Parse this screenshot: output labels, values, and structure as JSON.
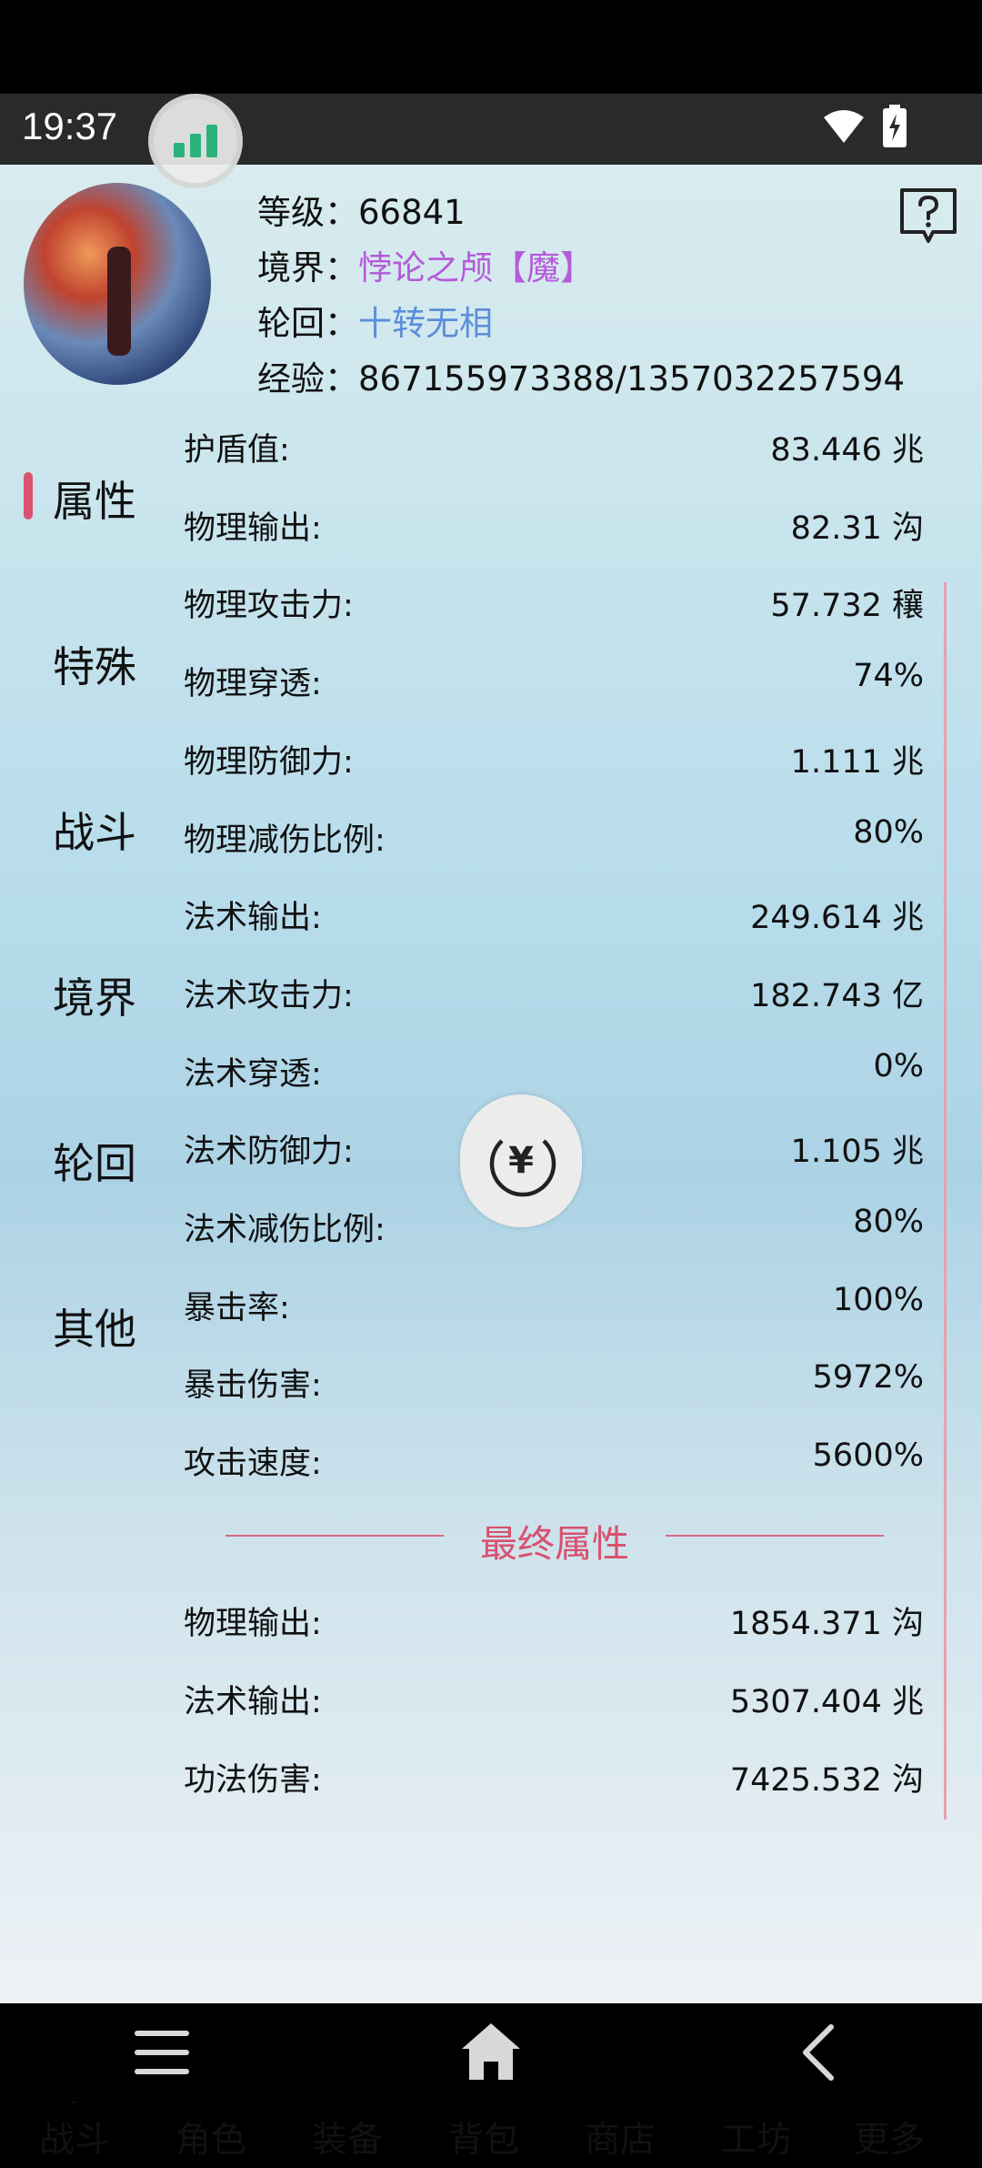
{
  "status_bar": {
    "time": "19:37"
  },
  "profile": {
    "level_label": "等级：",
    "level_value": "66841",
    "realm_label": "境界：",
    "realm_value": "悖论之颅【魔】",
    "reincarnation_label": "轮回：",
    "reincarnation_value": "十转无相",
    "exp_label": "经验：",
    "exp_value": "867155973388/1357032257594"
  },
  "side_tabs": [
    {
      "label": "属性",
      "active": true
    },
    {
      "label": "特殊",
      "active": false
    },
    {
      "label": "战斗",
      "active": false
    },
    {
      "label": "境界",
      "active": false
    },
    {
      "label": "轮回",
      "active": false
    },
    {
      "label": "其他",
      "active": false
    }
  ],
  "stats": [
    {
      "label": "护盾值:",
      "value": "83.446 兆"
    },
    {
      "label": "物理输出:",
      "value": "82.31 沟"
    },
    {
      "label": "物理攻击力:",
      "value": "57.732 穰"
    },
    {
      "label": "物理穿透:",
      "value": "74%"
    },
    {
      "label": "物理防御力:",
      "value": "1.111 兆"
    },
    {
      "label": "物理减伤比例:",
      "value": "80%"
    },
    {
      "label": "法术输出:",
      "value": "249.614 兆"
    },
    {
      "label": "法术攻击力:",
      "value": "182.743 亿"
    },
    {
      "label": "法术穿透:",
      "value": "0%"
    },
    {
      "label": "法术防御力:",
      "value": "1.105 兆"
    },
    {
      "label": "法术减伤比例:",
      "value": "80%"
    },
    {
      "label": "暴击率:",
      "value": "100%"
    },
    {
      "label": "暴击伤害:",
      "value": "5972%"
    },
    {
      "label": "攻击速度:",
      "value": "5600%"
    }
  ],
  "final_section": {
    "title": "最终属性",
    "stats": [
      {
        "label": "物理输出:",
        "value": "1854.371 沟"
      },
      {
        "label": "法术输出:",
        "value": "5307.404 兆"
      },
      {
        "label": "功法伤害:",
        "value": "7425.532 沟"
      }
    ]
  },
  "bottom_nav": [
    {
      "label": "战斗",
      "icon": "sword-icon"
    },
    {
      "label": "角色",
      "icon": "character-icon"
    },
    {
      "label": "装备",
      "icon": "armor-icon"
    },
    {
      "label": "背包",
      "icon": "bag-icon"
    },
    {
      "label": "商店",
      "icon": "shop-icon"
    },
    {
      "label": "工坊",
      "icon": "workshop-icon"
    },
    {
      "label": "更多",
      "icon": "more-icon"
    }
  ],
  "colors": {
    "accent_pink": "#d9506e",
    "realm_purple": "#b55ad9",
    "reincarnation_blue": "#5c8ed9"
  }
}
